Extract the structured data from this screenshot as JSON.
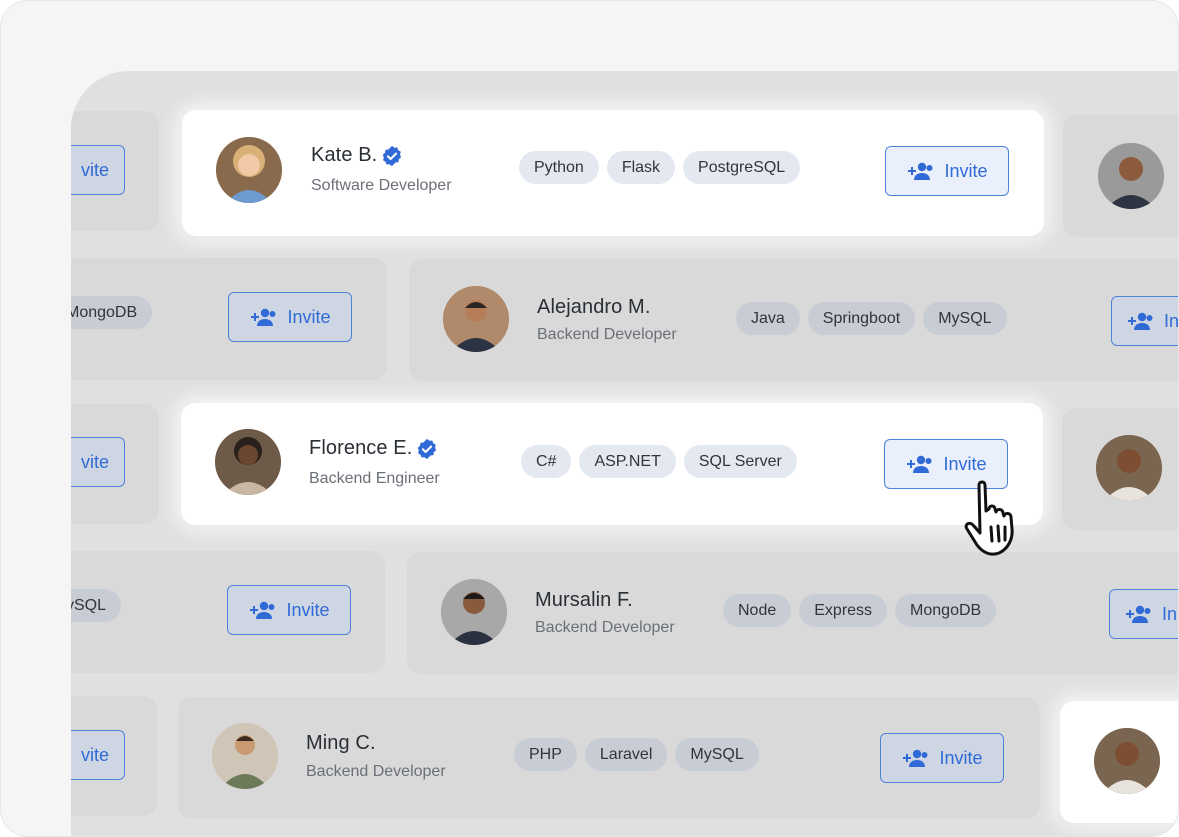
{
  "cards": [
    {
      "name": "Kate B.",
      "verified": true,
      "role": "Software Developer",
      "tags": [
        "Python",
        "Flask",
        "PostgreSQL"
      ],
      "invite": "Invite"
    },
    {
      "name": "Alejandro M.",
      "verified": false,
      "role": "Backend Developer",
      "tags": [
        "Java",
        "Springboot",
        "MySQL"
      ],
      "invite": "Invite"
    },
    {
      "name": "Florence E.",
      "verified": true,
      "role": "Backend Engineer",
      "tags": [
        "C#",
        "ASP.NET",
        "SQL Server"
      ],
      "invite": "Invite"
    },
    {
      "name": "Mursalin F.",
      "verified": false,
      "role": "Backend Developer",
      "tags": [
        "Node",
        "Express",
        "MongoDB"
      ],
      "invite": "Invite"
    },
    {
      "name": "Ming C.",
      "verified": false,
      "role": "Backend Developer",
      "tags": [
        "PHP",
        "Laravel",
        "MySQL"
      ],
      "invite": "Invite"
    }
  ],
  "partial": {
    "invite_cut": "vite",
    "invite_cut_right": "In",
    "tag_mongodb_cut": "MongoDB",
    "tag_mysql_cut": "ySQL",
    "invite": "Invite"
  },
  "colors": {
    "accent": "#2f6ad6",
    "verified": "#2f6ad6"
  }
}
